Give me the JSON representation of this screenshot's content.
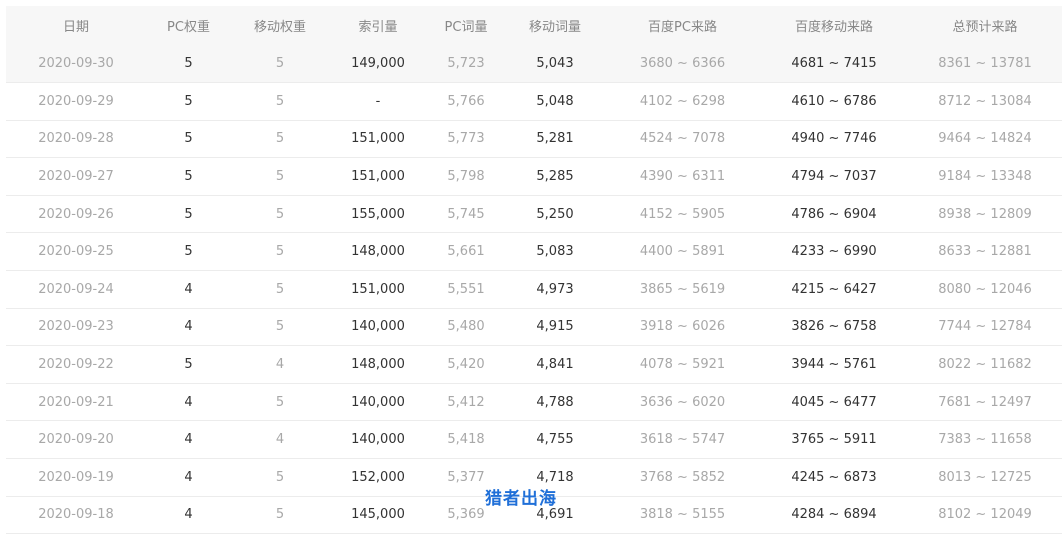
{
  "table": {
    "headers": [
      "日期",
      "PC权重",
      "移动权重",
      "索引量",
      "PC词量",
      "移动词量",
      "百度PC来路",
      "百度移动来路",
      "总预计来路"
    ],
    "rows": [
      [
        "2020-09-30",
        "5",
        "5",
        "149,000",
        "5,723",
        "5,043",
        "3680 ~ 6366",
        "4681 ~ 7415",
        "8361 ~ 13781"
      ],
      [
        "2020-09-29",
        "5",
        "5",
        "-",
        "5,766",
        "5,048",
        "4102 ~ 6298",
        "4610 ~ 6786",
        "8712 ~ 13084"
      ],
      [
        "2020-09-28",
        "5",
        "5",
        "151,000",
        "5,773",
        "5,281",
        "4524 ~ 7078",
        "4940 ~ 7746",
        "9464 ~ 14824"
      ],
      [
        "2020-09-27",
        "5",
        "5",
        "151,000",
        "5,798",
        "5,285",
        "4390 ~ 6311",
        "4794 ~ 7037",
        "9184 ~ 13348"
      ],
      [
        "2020-09-26",
        "5",
        "5",
        "155,000",
        "5,745",
        "5,250",
        "4152 ~ 5905",
        "4786 ~ 6904",
        "8938 ~ 12809"
      ],
      [
        "2020-09-25",
        "5",
        "5",
        "148,000",
        "5,661",
        "5,083",
        "4400 ~ 5891",
        "4233 ~ 6990",
        "8633 ~ 12881"
      ],
      [
        "2020-09-24",
        "4",
        "5",
        "151,000",
        "5,551",
        "4,973",
        "3865 ~ 5619",
        "4215 ~ 6427",
        "8080 ~ 12046"
      ],
      [
        "2020-09-23",
        "4",
        "5",
        "140,000",
        "5,480",
        "4,915",
        "3918 ~ 6026",
        "3826 ~ 6758",
        "7744 ~ 12784"
      ],
      [
        "2020-09-22",
        "5",
        "4",
        "148,000",
        "5,420",
        "4,841",
        "4078 ~ 5921",
        "3944 ~ 5761",
        "8022 ~ 11682"
      ],
      [
        "2020-09-21",
        "4",
        "5",
        "140,000",
        "5,412",
        "4,788",
        "3636 ~ 6020",
        "4045 ~ 6477",
        "7681 ~ 12497"
      ],
      [
        "2020-09-20",
        "4",
        "4",
        "140,000",
        "5,418",
        "4,755",
        "3618 ~ 5747",
        "3765 ~ 5911",
        "7383 ~ 11658"
      ],
      [
        "2020-09-19",
        "4",
        "5",
        "152,000",
        "5,377",
        "4,718",
        "3768 ~ 5852",
        "4245 ~ 6873",
        "8013 ~ 12725"
      ],
      [
        "2020-09-18",
        "4",
        "5",
        "145,000",
        "5,369",
        "4,691",
        "3818 ~ 5155",
        "4284 ~ 6894",
        "8102 ~ 12049"
      ]
    ]
  },
  "watermark": "猎者出海",
  "colors": {
    "header_bg": "#f7f7f7",
    "dark_text": "#333333",
    "light_text": "#a8a8a8",
    "watermark": "#1f6fd8"
  }
}
